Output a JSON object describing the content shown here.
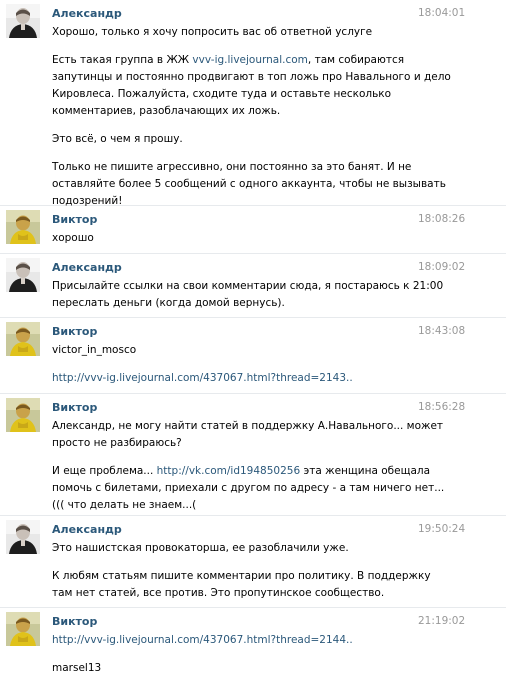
{
  "messages": [
    {
      "author": "Александр",
      "time": "18:04:01",
      "avatar": "avatar-alexander",
      "paragraphs": [
        [
          {
            "t": "Хорошо, только я хочу попросить вас об ответной услуге"
          }
        ],
        [
          {
            "t": "Есть такая группа в ЖЖ "
          },
          {
            "t": "vvv-ig.livejournal.com",
            "link": true
          },
          {
            "t": ", там собираются запутинцы и постоянно продвигают в топ ложь про Навального и дело Кировлеса. Пожалуйста, сходите туда и оставьте несколько комментариев, разоблачающих их ложь."
          }
        ],
        [
          {
            "t": "Это всё, о чем я прошу."
          }
        ],
        [
          {
            "t": "Только не пишите агрессивно, они постоянно за это банят. И не оставляйте более 5 сообщений с одного аккаунта, чтобы не вызывать подозрений!"
          }
        ]
      ]
    },
    {
      "author": "Виктор",
      "time": "18:08:26",
      "avatar": "avatar-viktor",
      "paragraphs": [
        [
          {
            "t": "хорошо"
          }
        ]
      ]
    },
    {
      "author": "Александр",
      "time": "18:09:02",
      "avatar": "avatar-alexander",
      "paragraphs": [
        [
          {
            "t": "Присылайте ссылки на свои комментарии сюда, я постараюсь к 21:00 переслать деньги (когда домой вернусь)."
          }
        ]
      ]
    },
    {
      "author": "Виктор",
      "time": "18:43:08",
      "avatar": "avatar-viktor",
      "paragraphs": [
        [
          {
            "t": "victor_in_mosco"
          }
        ],
        [
          {
            "t": "http://vvv-ig.livejournal.com/437067.html?thread=2143..",
            "link": true
          }
        ]
      ]
    },
    {
      "author": "Виктор",
      "time": "18:56:28",
      "avatar": "avatar-viktor",
      "paragraphs": [
        [
          {
            "t": "Александр, не могу найти статей в поддержку А.Навального... может просто не разбираюсь?"
          }
        ],
        [
          {
            "t": "И еще проблема... "
          },
          {
            "t": "http://vk.com/id194850256",
            "link": true
          },
          {
            "t": " эта женщина обещала помочь с билетами, приехали с другом по адресу - а там ничего нет...((( что делать не знаем...("
          }
        ]
      ]
    },
    {
      "author": "Александр",
      "time": "19:50:24",
      "avatar": "avatar-alexander",
      "paragraphs": [
        [
          {
            "t": "Это нашистская провокаторша, ее разоблачили уже."
          }
        ],
        [
          {
            "t": "К любям статьям пишите комментарии про политику. В поддержку там нет статей, все против. Это пропутинское сообщество."
          }
        ]
      ]
    },
    {
      "author": "Виктор",
      "time": "21:19:02",
      "avatar": "avatar-viktor",
      "paragraphs": [
        [
          {
            "t": "http://vvv-ig.livejournal.com/437067.html?thread=2144..",
            "link": true
          }
        ],
        [
          {
            "t": "marsel13"
          }
        ]
      ]
    }
  ]
}
